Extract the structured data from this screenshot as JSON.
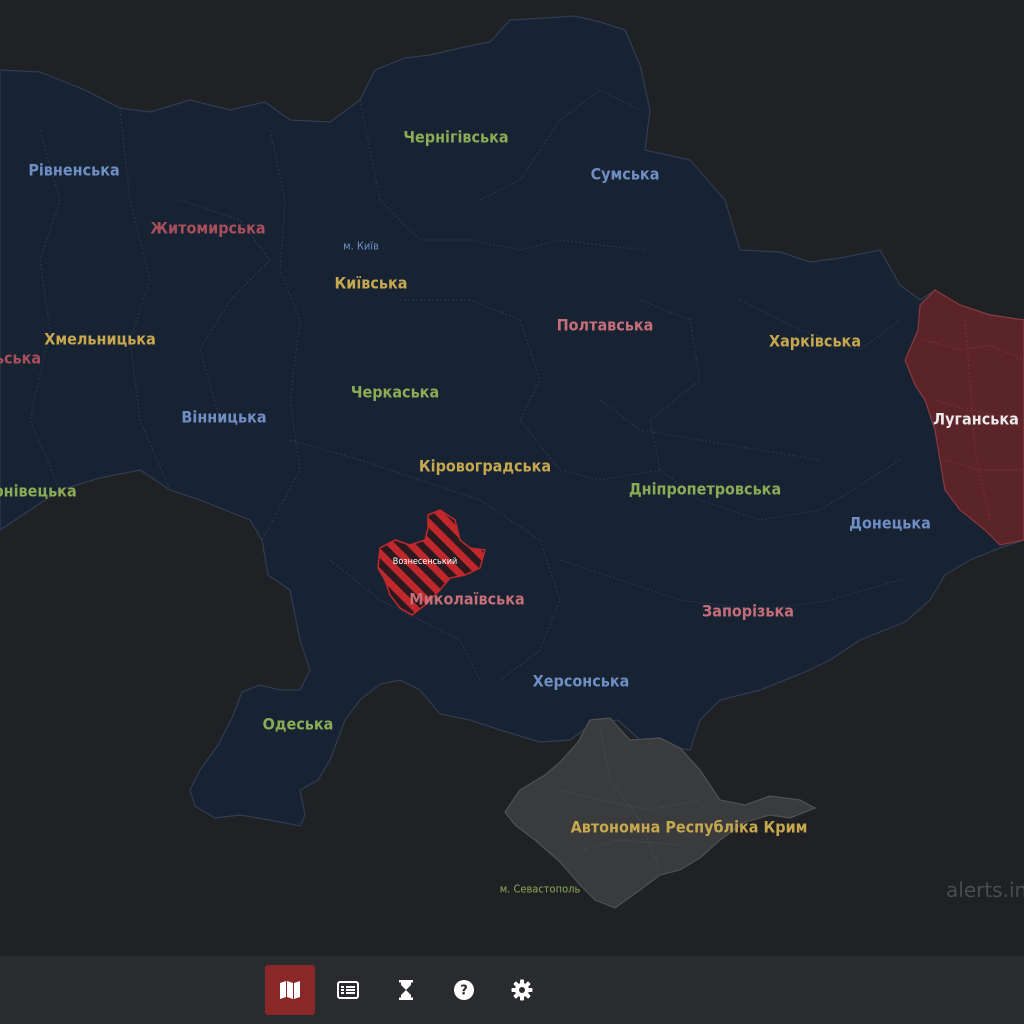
{
  "map": {
    "regions": [
      {
        "id": "rivne",
        "name": "Рівненська",
        "color": "#6f8fc4"
      },
      {
        "id": "zhytomyr",
        "name": "Житомирська",
        "color": "#a84f5b"
      },
      {
        "id": "kyiv-city",
        "name": "м. Київ",
        "color": "#6f8fc4"
      },
      {
        "id": "kyiv",
        "name": "Київська",
        "color": "#c7a84f"
      },
      {
        "id": "chernihiv",
        "name": "Чернігівська",
        "color": "#8bab55"
      },
      {
        "id": "sumy",
        "name": "Сумська",
        "color": "#6f8fc4"
      },
      {
        "id": "poltava",
        "name": "Полтавська",
        "color": "#c56e78"
      },
      {
        "id": "kharkiv",
        "name": "Харківська",
        "color": "#c7a84f"
      },
      {
        "id": "khmelnytskyi",
        "name": "Хмельницька",
        "color": "#c7a84f"
      },
      {
        "id": "ternopil-partial",
        "name": "ьська",
        "color": "#a84f5b"
      },
      {
        "id": "cherkasy",
        "name": "Черкаська",
        "color": "#8bab55"
      },
      {
        "id": "vinnytsia",
        "name": "Вінницька",
        "color": "#6f8fc4"
      },
      {
        "id": "luhansk",
        "name": "Луганська",
        "color": "#ece9ea"
      },
      {
        "id": "kirovohrad",
        "name": "Кіровоградська",
        "color": "#c7a84f"
      },
      {
        "id": "dnipro",
        "name": "Дніпропетровська",
        "color": "#8bab55"
      },
      {
        "id": "chernivtsi-partial",
        "name": "рнівецька",
        "color": "#8bab55"
      },
      {
        "id": "donetsk",
        "name": "Донецька",
        "color": "#6f8fc4"
      },
      {
        "id": "voznesensk",
        "name": "Вознесенський",
        "color": "#ffffff"
      },
      {
        "id": "mykolaiv",
        "name": "Миколаївська",
        "color": "#c56e78"
      },
      {
        "id": "zaporizhzhia",
        "name": "Запорізька",
        "color": "#c56e78"
      },
      {
        "id": "kherson",
        "name": "Херсонська",
        "color": "#6f8fc4"
      },
      {
        "id": "odesa",
        "name": "Одеська",
        "color": "#8bab55"
      },
      {
        "id": "crimea",
        "name": "Автономна Республіка Крим",
        "color": "#c7a84f"
      },
      {
        "id": "sevastopol",
        "name": "м. Севастополь",
        "color": "#8bab55"
      }
    ],
    "alerts": [
      {
        "region": "Луганська",
        "status": "active alert"
      },
      {
        "region": "Вознесенський",
        "status": "active alert"
      }
    ],
    "colors": {
      "background": "#202124",
      "territory": "#172233",
      "border": "#2f3d52",
      "alert": "#5a2428",
      "alert_stripes": "#c0282c",
      "occupied": "#3a3b3d"
    }
  },
  "watermark": "alerts.in.",
  "toolbar": {
    "buttons": [
      {
        "name": "map-button",
        "icon": "map-icon",
        "active": true
      },
      {
        "name": "list-button",
        "icon": "list-icon",
        "active": false
      },
      {
        "name": "history-button",
        "icon": "hourglass-icon",
        "active": false
      },
      {
        "name": "help-button",
        "icon": "question-icon",
        "active": false
      },
      {
        "name": "settings-button",
        "icon": "gear-icon",
        "active": false
      }
    ]
  }
}
